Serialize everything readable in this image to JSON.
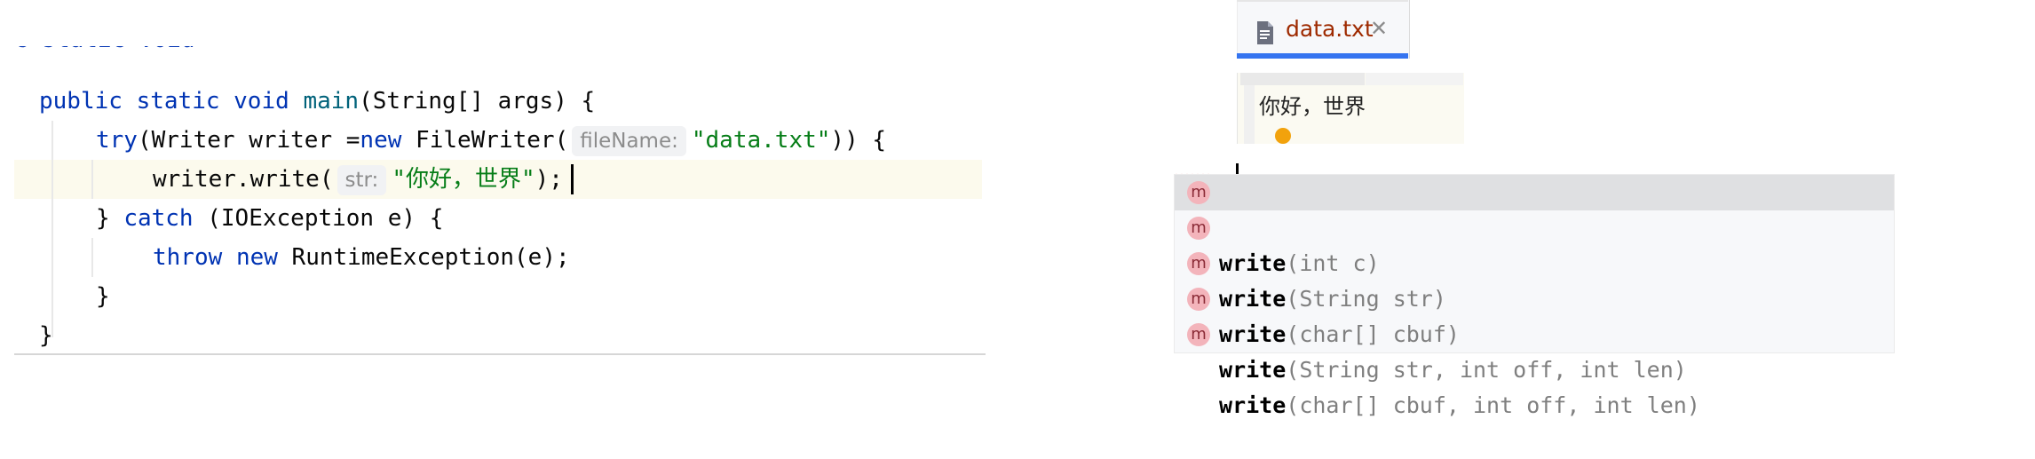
{
  "editor": {
    "top_partial": "c static void",
    "lines": {
      "l1": {
        "kw1": "public",
        "kw2": "static",
        "kw3": "void",
        "fn": "main",
        "rest": "(String[] args) {"
      },
      "l2": {
        "kw": "try",
        "pre_hint": "(Writer writer =",
        "kw_new": "new",
        "ctor": " FileWriter(",
        "hint": "fileName:",
        "str": "\"data.txt\"",
        "rest": ")) {"
      },
      "l3": {
        "call": "writer.write(",
        "hint": "str:",
        "str": "\"你好，世界\"",
        "rest": ");"
      },
      "l4": {
        "brace": "} ",
        "kw": "catch",
        "rest": " (IOException e) {"
      },
      "l5": {
        "kw1": "throw",
        "kw2": "new",
        "rest": " RuntimeException(e);"
      },
      "l6": {
        "brace": "}"
      },
      "l7": {
        "brace": "}"
      }
    }
  },
  "file_tab": {
    "label": "data.txt",
    "close": "✕",
    "icon": "text-file-icon"
  },
  "preview": {
    "content": "你好，世界"
  },
  "completion": {
    "items": [
      {
        "icon": "m",
        "prefix": "w",
        "name": "rite",
        "params": "(int c)",
        "selected": true
      },
      {
        "icon": "m",
        "prefix": "w",
        "name": "rite",
        "params": "(String str)",
        "selected": false
      },
      {
        "icon": "m",
        "prefix": "w",
        "name": "rite",
        "params": "(char[] cbuf)",
        "selected": false
      },
      {
        "icon": "m",
        "prefix": "w",
        "name": "rite",
        "params": "(String str, int off, int len)",
        "selected": false
      },
      {
        "icon": "m",
        "prefix": "w",
        "name": "rite",
        "params": "(char[] cbuf, int off, int len)",
        "selected": false
      }
    ]
  },
  "colors": {
    "keyword": "#0033b3",
    "function": "#00627a",
    "string": "#067d17",
    "tab_accent": "#3574f0",
    "file_label": "#9e2a00",
    "selection": "#dfe0e2"
  }
}
